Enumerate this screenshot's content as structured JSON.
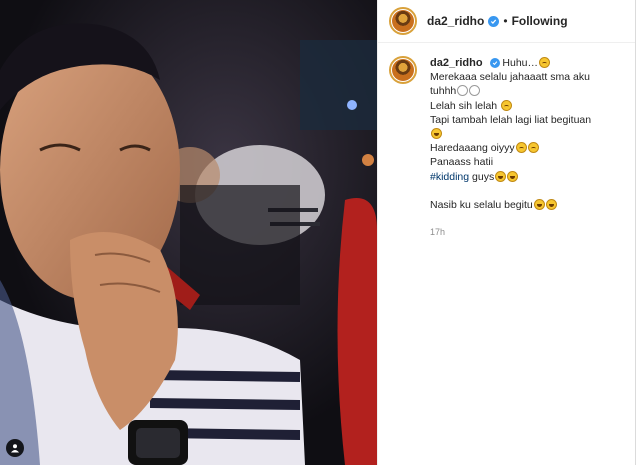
{
  "post": {
    "username": "da2_ridho",
    "separator": "•",
    "follow_status": "Following"
  },
  "caption": {
    "username": "da2_ridho",
    "lines": [
      "Huhu…",
      "Merekaaa selalu jahaaatt sma aku",
      "tuhhh",
      "Lelah sih lelah",
      "Tapi tambah lelah lagi liat begituan",
      "",
      "Haredaaang oiyyy",
      "Panaass hatii",
      "#kidding",
      " guys",
      "Nasib ku selalu begitu"
    ],
    "time": "17h"
  },
  "icons": {
    "verified": "verified-badge-icon",
    "user_tag": "user-tag-icon"
  },
  "colors": {
    "verified_blue": "#3897f0",
    "hashtag": "#00376b",
    "muted": "#8e8e8e"
  }
}
